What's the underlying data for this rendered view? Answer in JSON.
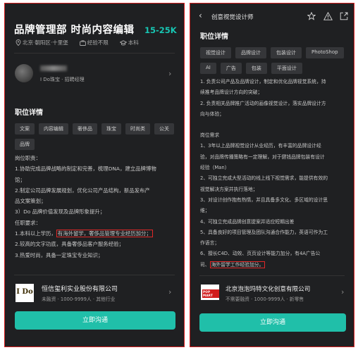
{
  "left": {
    "job_title": "品牌管理部 时尚内容编辑",
    "salary": "15-25K",
    "location": "北京·朝阳区·十里堡",
    "experience": "经验不限",
    "education": "本科",
    "recruiter_sub": "I Do珠宝 · 招聘经理",
    "section_title": "职位详情",
    "tags": [
      "文案",
      "内容编辑",
      "奢侈品",
      "珠宝",
      "时尚类",
      "公关",
      "品牌"
    ],
    "desc": {
      "l1": "岗位职责：",
      "l2": "1.协助完成品牌战略的制定和完善，梳理DNA，建立品牌博物",
      "l3": "馆；",
      "l4": "2.制定公司品牌发展规划，优化公司产品结构，新品发布产",
      "l5": "品文案策划；",
      "l6": "3）Do 品牌价值发现及品牌形象提升；",
      "l7": "任职要求：",
      "l8a": "1.本科以上学历，",
      "l8b": "有海外留学，奢侈品管理专业经历加分；",
      "l9": "2.较高的文字功底，具备奢侈品客户服务经验；",
      "l10": "3.热爱时尚，具备一定珠宝专业知识；"
    },
    "logo_text": "I Do",
    "company": "恒信玺利实业股份有限公司",
    "company_meta": "未融资 · 1000-9999人 · 其他行业",
    "button": "立即沟通"
  },
  "right": {
    "header_title": "创意视觉设计师",
    "section_title": "职位详情",
    "tags": [
      "视觉设计",
      "品牌设计",
      "包装设计",
      "PhotoShop",
      "AI",
      "广告",
      "包装",
      "平面设计"
    ],
    "desc": {
      "l1": "1. 负责公司产品及品牌设计，制定和优化品牌视觉系统，持",
      "l2": "续推考品牌设计方向的突破；",
      "l3": "2. 负责相关品牌推广活动的画像视觉设计，落实品牌设计方",
      "l4": "向与体验；",
      "l5": "岗位需求",
      "l6": "1、3年以上品牌视觉设计从业经历，有丰富的品牌设计经",
      "l7": "验，对品牌传播策略有一定理解，对于健钱品牌包装有设计",
      "l8": "经验（Man）",
      "l9": "2、可独立完成大型活动的线上线下视觉需求，能提供有效的",
      "l10": "视觉解决方案并执行落地；",
      "l11": "3、对设计创作抱有热情，并且具备多文化、多区域的设计思",
      "l12": "维；",
      "l13": "4、可独立完成品牌创意提案并适应短期出差",
      "l14": "5、具备良好的项目管理及团队沟通合作能力，英语可作为工",
      "l15": "作语言；",
      "l16": "6、擅长C4D、动效、页页设计等能力加分，有4A广告公",
      "l17a": "司、",
      "l17b": "海外留学工作经验加分。"
    },
    "logo_text": "POP MART",
    "company": "北京泡泡玛特文化创意有限公司",
    "company_meta": "不需要融资 · 1000-9999人 · 新零售",
    "button": "立即沟通"
  }
}
